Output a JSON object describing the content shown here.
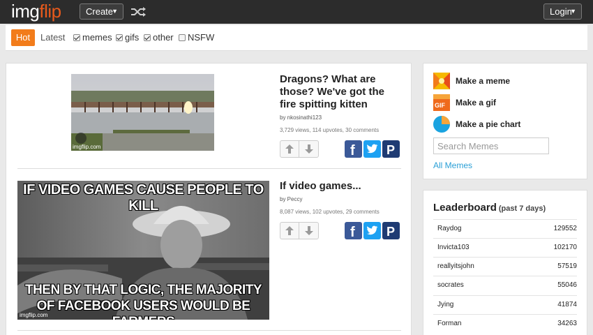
{
  "header": {
    "logo_part1": "img",
    "logo_part2": "flip",
    "create_label": "Create",
    "login_label": "Login",
    "caret": "▼"
  },
  "filters": {
    "hot": "Hot",
    "latest": "Latest",
    "items": [
      {
        "label": "memes",
        "checked": true
      },
      {
        "label": "gifs",
        "checked": true
      },
      {
        "label": "other",
        "checked": true
      },
      {
        "label": "NSFW",
        "checked": false
      }
    ]
  },
  "posts": [
    {
      "title": "Dragons? What are those? We've got the fire spitting kitten",
      "title_lines": [
        "Dragons? What are",
        "those? We've got the",
        "fire spitting kitten"
      ],
      "author": "by nkosinathi123",
      "stats": "3,729 views, 114 upvotes, 30 comments",
      "watermark": "imgflip.com"
    },
    {
      "title": "If video games...",
      "author": "by Peccy",
      "stats": "8,087 views, 102 upvotes, 29 comments",
      "meme_top": "IF VIDEO GAMES CAUSE PEOPLE TO KILL",
      "meme_bottom_1": "THEN BY THAT LOGIC, THE MAJORITY",
      "meme_bottom_2": "OF FACEBOOK USERS WOULD BE FARMERS",
      "watermark": "imgflip.com"
    }
  ],
  "share": {
    "facebook": "f",
    "pinterest": "P"
  },
  "make": {
    "items": [
      {
        "label": "Make a meme",
        "icon": "meme-icon"
      },
      {
        "label": "Make a gif",
        "icon": "gif-icon",
        "badge": "GIF"
      },
      {
        "label": "Make a pie chart",
        "icon": "pie-chart-icon"
      }
    ],
    "search_placeholder": "Search Memes",
    "all_memes": "All Memes"
  },
  "leaderboard": {
    "title": "Leaderboard",
    "subtitle": "(past 7 days)",
    "rows": [
      {
        "name": "Raydog",
        "score": "129552"
      },
      {
        "name": "Invicta103",
        "score": "102170"
      },
      {
        "name": "reallyitsjohn",
        "score": "57519"
      },
      {
        "name": "socrates",
        "score": "55046"
      },
      {
        "name": "Jying",
        "score": "41874"
      },
      {
        "name": "Forman",
        "score": "34263"
      }
    ]
  },
  "colors": {
    "header_bg": "#2c2c2c",
    "accent_orange": "#f27c1b",
    "link_blue": "#2a9fd6",
    "facebook": "#3b5998",
    "twitter": "#1da1f2",
    "pinterest": "#1f3b73"
  }
}
